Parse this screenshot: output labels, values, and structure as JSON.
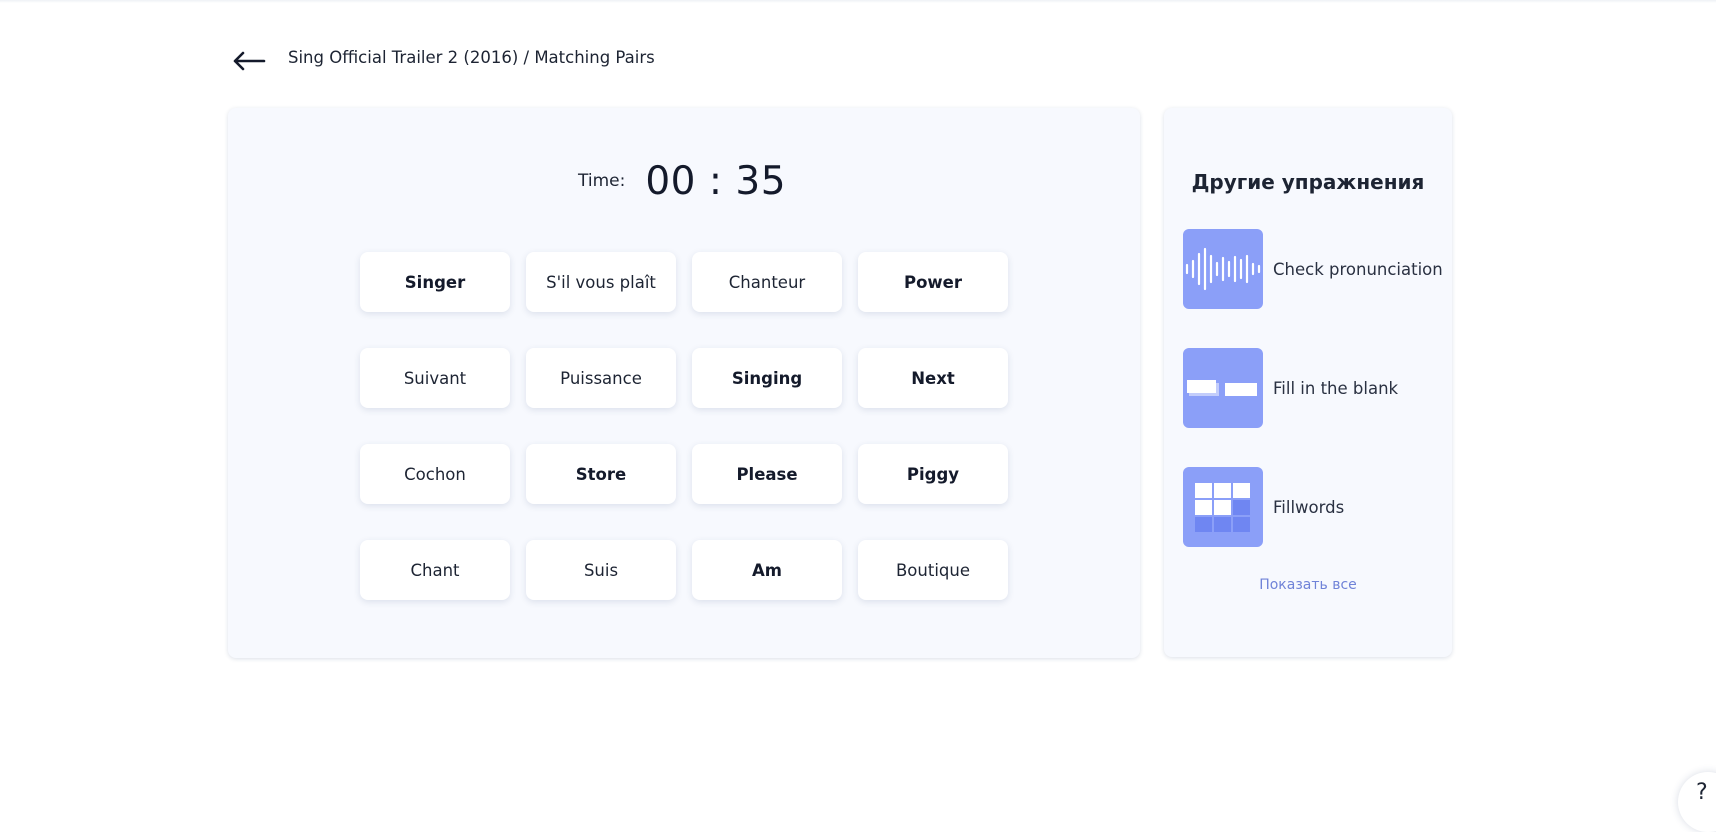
{
  "header": {
    "back_icon": "arrow-left-icon",
    "breadcrumb": "Sing Official Trailer 2 (2016) / Matching Pairs"
  },
  "game": {
    "timer_label": "Time:",
    "timer_value": "00 : 35",
    "tiles": [
      {
        "label": "Singer",
        "bold": true
      },
      {
        "label": "S'il vous plaît",
        "bold": false
      },
      {
        "label": "Chanteur",
        "bold": false
      },
      {
        "label": "Power",
        "bold": true
      },
      {
        "label": "Suivant",
        "bold": false
      },
      {
        "label": "Puissance",
        "bold": false
      },
      {
        "label": "Singing",
        "bold": true
      },
      {
        "label": "Next",
        "bold": true
      },
      {
        "label": "Cochon",
        "bold": false
      },
      {
        "label": "Store",
        "bold": true
      },
      {
        "label": "Please",
        "bold": true
      },
      {
        "label": "Piggy",
        "bold": true
      },
      {
        "label": "Chant",
        "bold": false
      },
      {
        "label": "Suis",
        "bold": false
      },
      {
        "label": "Am",
        "bold": true
      },
      {
        "label": "Boutique",
        "bold": false
      }
    ]
  },
  "sidebar": {
    "title": "Другие упражнения",
    "items": [
      {
        "label": "Check pronunciation",
        "icon": "soundwave-icon"
      },
      {
        "label": "Fill in the blank",
        "icon": "fill-blank-icon"
      },
      {
        "label": "Fillwords",
        "icon": "fillwords-grid-icon"
      }
    ],
    "show_all": "Показать все"
  },
  "help": {
    "glyph": "?",
    "icon": "help-icon"
  },
  "colors": {
    "card_bg": "#f7f9fe",
    "thumb_bg": "#8b9ff8",
    "link": "#7083d8",
    "text": "#1d2433"
  }
}
